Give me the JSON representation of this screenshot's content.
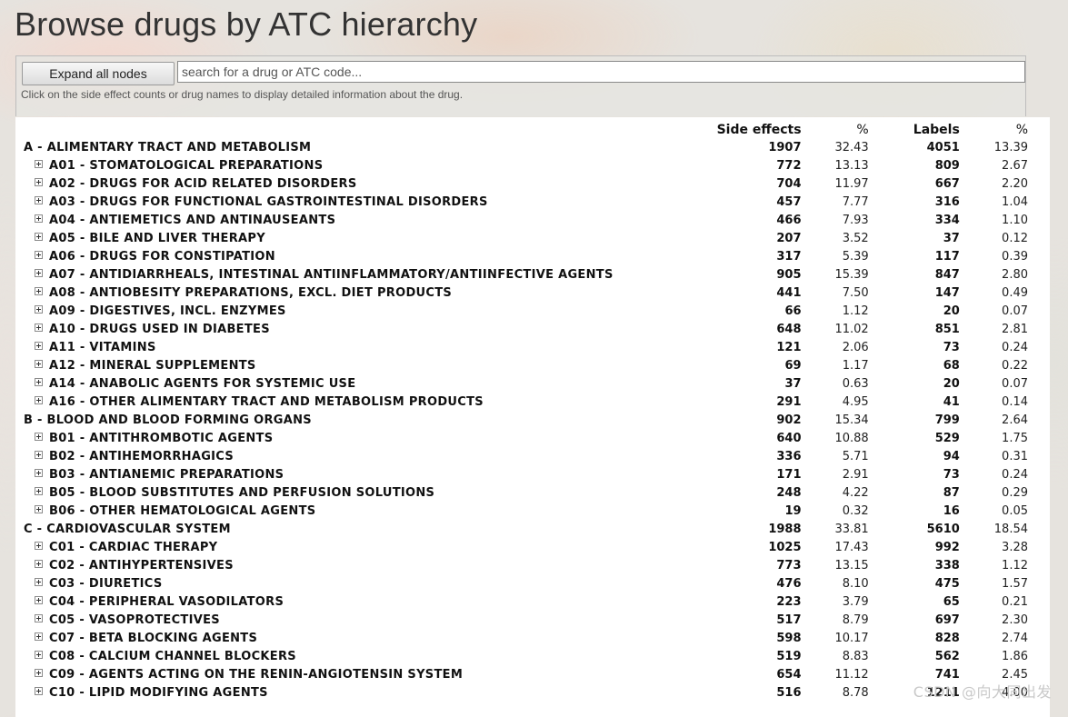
{
  "page": {
    "title": "Browse drugs by ATC hierarchy",
    "expand_button": "Expand all nodes",
    "search_placeholder": "search for a drug or ATC code...",
    "hint": "Click on the side effect counts or drug names to display detailed information about the drug.",
    "watermark": "CSDN @向大同出发"
  },
  "table": {
    "headers": {
      "side_effects": "Side effects",
      "side_effects_pct": "%",
      "labels": "Labels",
      "labels_pct": "%"
    },
    "rows": [
      {
        "level": "top",
        "name": "A - ALIMENTARY TRACT AND METABOLISM",
        "se": "1907",
        "se_pct": "32.43",
        "labels": "4051",
        "labels_pct": "13.39"
      },
      {
        "level": "sub",
        "name": "A01 - STOMATOLOGICAL PREPARATIONS",
        "se": "772",
        "se_pct": "13.13",
        "labels": "809",
        "labels_pct": "2.67"
      },
      {
        "level": "sub",
        "name": "A02 - DRUGS FOR ACID RELATED DISORDERS",
        "se": "704",
        "se_pct": "11.97",
        "labels": "667",
        "labels_pct": "2.20"
      },
      {
        "level": "sub",
        "name": "A03 - DRUGS FOR FUNCTIONAL GASTROINTESTINAL DISORDERS",
        "se": "457",
        "se_pct": "7.77",
        "labels": "316",
        "labels_pct": "1.04"
      },
      {
        "level": "sub",
        "name": "A04 - ANTIEMETICS AND ANTINAUSEANTS",
        "se": "466",
        "se_pct": "7.93",
        "labels": "334",
        "labels_pct": "1.10"
      },
      {
        "level": "sub",
        "name": "A05 - BILE AND LIVER THERAPY",
        "se": "207",
        "se_pct": "3.52",
        "labels": "37",
        "labels_pct": "0.12"
      },
      {
        "level": "sub",
        "name": "A06 - DRUGS FOR CONSTIPATION",
        "se": "317",
        "se_pct": "5.39",
        "labels": "117",
        "labels_pct": "0.39"
      },
      {
        "level": "sub",
        "name": "A07 - ANTIDIARRHEALS, INTESTINAL ANTIINFLAMMATORY/ANTIINFECTIVE AGENTS",
        "se": "905",
        "se_pct": "15.39",
        "labels": "847",
        "labels_pct": "2.80"
      },
      {
        "level": "sub",
        "name": "A08 - ANTIOBESITY PREPARATIONS, EXCL. DIET PRODUCTS",
        "se": "441",
        "se_pct": "7.50",
        "labels": "147",
        "labels_pct": "0.49"
      },
      {
        "level": "sub",
        "name": "A09 - DIGESTIVES, INCL. ENZYMES",
        "se": "66",
        "se_pct": "1.12",
        "labels": "20",
        "labels_pct": "0.07"
      },
      {
        "level": "sub",
        "name": "A10 - DRUGS USED IN DIABETES",
        "se": "648",
        "se_pct": "11.02",
        "labels": "851",
        "labels_pct": "2.81"
      },
      {
        "level": "sub",
        "name": "A11 - VITAMINS",
        "se": "121",
        "se_pct": "2.06",
        "labels": "73",
        "labels_pct": "0.24"
      },
      {
        "level": "sub",
        "name": "A12 - MINERAL SUPPLEMENTS",
        "se": "69",
        "se_pct": "1.17",
        "labels": "68",
        "labels_pct": "0.22"
      },
      {
        "level": "sub",
        "name": "A14 - ANABOLIC AGENTS FOR SYSTEMIC USE",
        "se": "37",
        "se_pct": "0.63",
        "labels": "20",
        "labels_pct": "0.07"
      },
      {
        "level": "sub",
        "name": "A16 - OTHER ALIMENTARY TRACT AND METABOLISM PRODUCTS",
        "se": "291",
        "se_pct": "4.95",
        "labels": "41",
        "labels_pct": "0.14"
      },
      {
        "level": "top",
        "name": "B - BLOOD AND BLOOD FORMING ORGANS",
        "se": "902",
        "se_pct": "15.34",
        "labels": "799",
        "labels_pct": "2.64"
      },
      {
        "level": "sub",
        "name": "B01 - ANTITHROMBOTIC AGENTS",
        "se": "640",
        "se_pct": "10.88",
        "labels": "529",
        "labels_pct": "1.75"
      },
      {
        "level": "sub",
        "name": "B02 - ANTIHEMORRHAGICS",
        "se": "336",
        "se_pct": "5.71",
        "labels": "94",
        "labels_pct": "0.31"
      },
      {
        "level": "sub",
        "name": "B03 - ANTIANEMIC PREPARATIONS",
        "se": "171",
        "se_pct": "2.91",
        "labels": "73",
        "labels_pct": "0.24"
      },
      {
        "level": "sub",
        "name": "B05 - BLOOD SUBSTITUTES AND PERFUSION SOLUTIONS",
        "se": "248",
        "se_pct": "4.22",
        "labels": "87",
        "labels_pct": "0.29"
      },
      {
        "level": "sub",
        "name": "B06 - OTHER HEMATOLOGICAL AGENTS",
        "se": "19",
        "se_pct": "0.32",
        "labels": "16",
        "labels_pct": "0.05"
      },
      {
        "level": "top",
        "name": "C - CARDIOVASCULAR SYSTEM",
        "se": "1988",
        "se_pct": "33.81",
        "labels": "5610",
        "labels_pct": "18.54"
      },
      {
        "level": "sub",
        "name": "C01 - CARDIAC THERAPY",
        "se": "1025",
        "se_pct": "17.43",
        "labels": "992",
        "labels_pct": "3.28"
      },
      {
        "level": "sub",
        "name": "C02 - ANTIHYPERTENSIVES",
        "se": "773",
        "se_pct": "13.15",
        "labels": "338",
        "labels_pct": "1.12"
      },
      {
        "level": "sub",
        "name": "C03 - DIURETICS",
        "se": "476",
        "se_pct": "8.10",
        "labels": "475",
        "labels_pct": "1.57"
      },
      {
        "level": "sub",
        "name": "C04 - PERIPHERAL VASODILATORS",
        "se": "223",
        "se_pct": "3.79",
        "labels": "65",
        "labels_pct": "0.21"
      },
      {
        "level": "sub",
        "name": "C05 - VASOPROTECTIVES",
        "se": "517",
        "se_pct": "8.79",
        "labels": "697",
        "labels_pct": "2.30"
      },
      {
        "level": "sub",
        "name": "C07 - BETA BLOCKING AGENTS",
        "se": "598",
        "se_pct": "10.17",
        "labels": "828",
        "labels_pct": "2.74"
      },
      {
        "level": "sub",
        "name": "C08 - CALCIUM CHANNEL BLOCKERS",
        "se": "519",
        "se_pct": "8.83",
        "labels": "562",
        "labels_pct": "1.86"
      },
      {
        "level": "sub",
        "name": "C09 - AGENTS ACTING ON THE RENIN-ANGIOTENSIN SYSTEM",
        "se": "654",
        "se_pct": "11.12",
        "labels": "741",
        "labels_pct": "2.45"
      },
      {
        "level": "sub",
        "name": "C10 - LIPID MODIFYING AGENTS",
        "se": "516",
        "se_pct": "8.78",
        "labels": "1211",
        "labels_pct": "4.00"
      }
    ]
  }
}
